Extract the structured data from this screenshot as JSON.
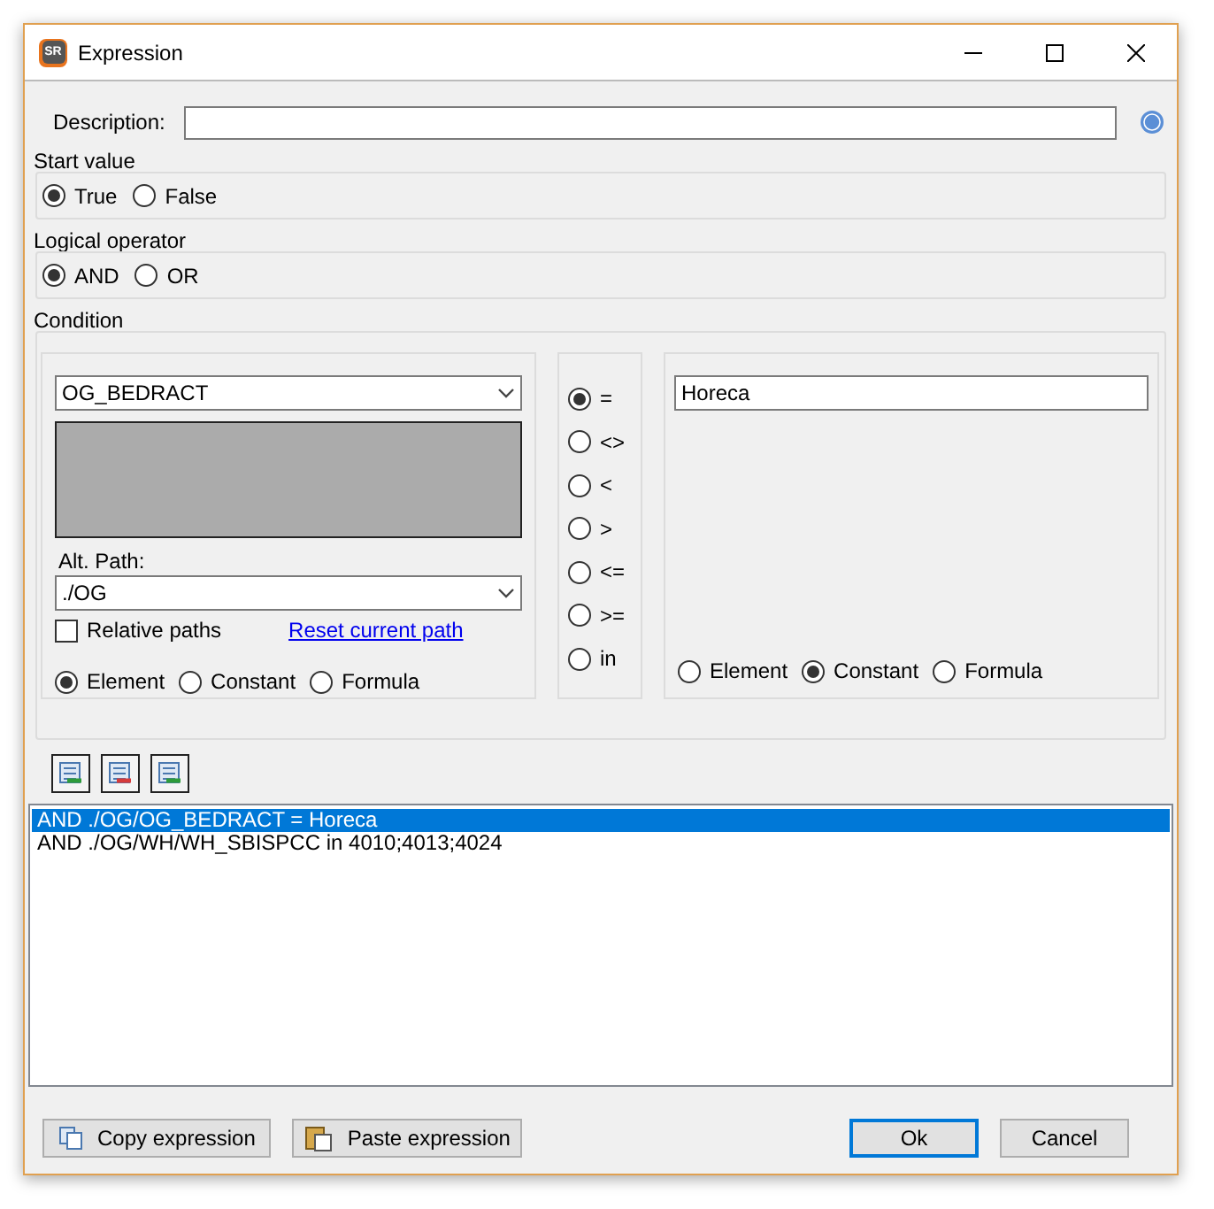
{
  "window": {
    "title": "Expression",
    "icon_text": "SR"
  },
  "description": {
    "label": "Description:"
  },
  "start_value": {
    "title": "Start value",
    "options": [
      {
        "label": "True",
        "selected": true
      },
      {
        "label": "False",
        "selected": false
      }
    ]
  },
  "logical_operator": {
    "title": "Logical operator",
    "options": [
      {
        "label": "AND",
        "selected": true
      },
      {
        "label": "OR",
        "selected": false
      }
    ]
  },
  "condition": {
    "title": "Condition",
    "left": {
      "field": "OG_BEDRACT",
      "alt_path_label": "Alt. Path:",
      "alt_path": "./OG",
      "relative_paths": {
        "label": "Relative paths",
        "checked": false
      },
      "reset_link": "Reset current path",
      "sources": [
        {
          "label": "Element",
          "selected": true
        },
        {
          "label": "Constant",
          "selected": false
        },
        {
          "label": "Formula",
          "selected": false
        }
      ]
    },
    "operators": [
      {
        "label": "=",
        "selected": true
      },
      {
        "label": "<>",
        "selected": false
      },
      {
        "label": "<",
        "selected": false
      },
      {
        "label": ">",
        "selected": false
      },
      {
        "label": "<=",
        "selected": false
      },
      {
        "label": ">=",
        "selected": false
      },
      {
        "label": "in",
        "selected": false
      }
    ],
    "right": {
      "value": "Horeca",
      "sources": [
        {
          "label": "Element",
          "selected": false
        },
        {
          "label": "Constant",
          "selected": true
        },
        {
          "label": "Formula",
          "selected": false
        }
      ]
    }
  },
  "expressions": [
    {
      "text": "AND ./OG/OG_BEDRACT = Horeca",
      "selected": true
    },
    {
      "text": "AND ./OG/WH/WH_SBISPCC in 4010;4013;4024",
      "selected": false
    }
  ],
  "buttons": {
    "copy": "Copy expression",
    "paste": "Paste expression",
    "ok": "Ok",
    "cancel": "Cancel"
  }
}
